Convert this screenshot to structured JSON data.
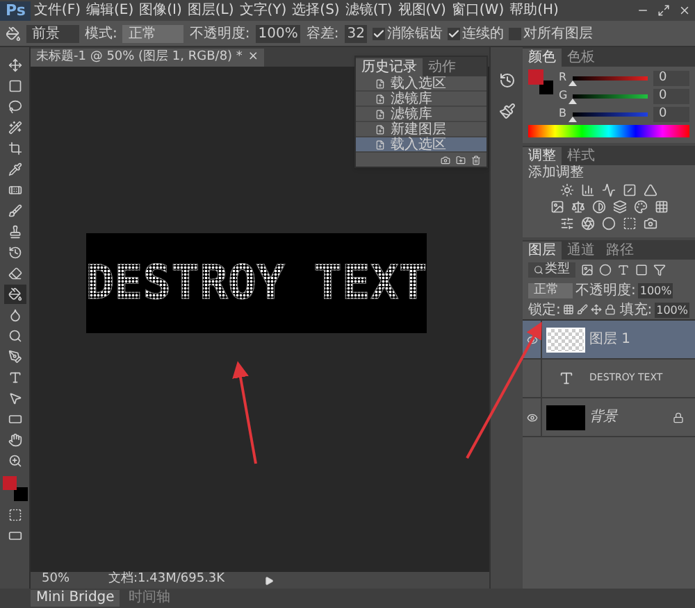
{
  "menu_bar": {
    "logo": "Ps",
    "items": [
      "文件(F)",
      "编辑(E)",
      "图像(I)",
      "图层(L)",
      "文字(Y)",
      "选择(S)",
      "滤镜(T)",
      "视图(V)",
      "窗口(W)",
      "帮助(H)"
    ]
  },
  "options_bar": {
    "fill_source": "前景",
    "mode_label": "模式:",
    "mode": "正常",
    "opacity_label": "不透明度:",
    "opacity": "100%",
    "tolerance_label": "容差:",
    "tolerance": "32",
    "checkboxes": [
      {
        "label": "消除锯齿",
        "checked": true
      },
      {
        "label": "连续的",
        "checked": true
      },
      {
        "label": "对所有图层",
        "checked": false
      }
    ]
  },
  "document_tab": {
    "title": "未标题-1 @ 50% (图层 1, RGB/8) *",
    "close": "×"
  },
  "tools": [
    {
      "selected": false
    },
    {
      "selected": false
    },
    {
      "selected": false
    },
    {
      "selected": false
    },
    {
      "selected": false
    },
    {
      "selected": false
    },
    {
      "selected": false
    },
    {
      "selected": false
    },
    {
      "selected": false
    },
    {
      "selected": false
    },
    {
      "selected": false
    },
    {
      "selected": true
    },
    {
      "selected": false
    },
    {
      "selected": false
    },
    {
      "selected": false
    },
    {
      "selected": false
    },
    {
      "selected": false
    },
    {
      "selected": false
    },
    {
      "selected": false
    },
    {
      "selected": false
    }
  ],
  "swatches": [
    {
      "kind": "foreground",
      "color": "#c41e2a"
    },
    {
      "kind": "background",
      "color": "#000000"
    }
  ],
  "canvas": {
    "text": "DESTROY TEXT"
  },
  "status_bar": {
    "zoom": "50%",
    "document": "文档:1.43M/695.3K"
  },
  "bottom_tabs": [
    {
      "label": "Mini Bridge",
      "selected": true
    },
    {
      "label": "时间轴",
      "selected": false
    }
  ],
  "history_panel": {
    "tabs": [
      {
        "label": "历史记录",
        "selected": true
      },
      {
        "label": "动作",
        "selected": false
      }
    ],
    "items": [
      {
        "label": "载入选区",
        "selected": false
      },
      {
        "label": "滤镜库",
        "selected": false
      },
      {
        "label": "滤镜库",
        "selected": false
      },
      {
        "label": "新建图层",
        "selected": false
      },
      {
        "label": "载入选区",
        "selected": true
      }
    ]
  },
  "color_panel": {
    "tabs": [
      {
        "label": "颜色",
        "selected": true
      },
      {
        "label": "色板",
        "selected": false
      }
    ],
    "channels": [
      {
        "name": "R",
        "level": 0,
        "reading": "0"
      },
      {
        "name": "G",
        "level": 0,
        "reading": "0"
      },
      {
        "name": "B",
        "level": 0,
        "reading": "0"
      }
    ]
  },
  "adjustments_panel": {
    "tabs": [
      {
        "label": "调整",
        "selected": true
      },
      {
        "label": "样式",
        "selected": false
      }
    ],
    "heading": "添加调整"
  },
  "layers_panel": {
    "tabs": [
      {
        "label": "图层",
        "selected": true
      },
      {
        "label": "通道",
        "selected": false
      },
      {
        "label": "路径",
        "selected": false
      }
    ],
    "filter": "类型",
    "blend_mode": "正常",
    "opacity_label": "不透明度:",
    "opacity": "100%",
    "lock_label": "锁定:",
    "fill_label": "填充:",
    "fill": "100%",
    "layers": [
      {
        "name": "图层 1",
        "kind": "pixel",
        "visible": true,
        "selected": true,
        "locked": false
      },
      {
        "name": "DESTROY TEXT",
        "kind": "text",
        "visible": false,
        "selected": false,
        "locked": false
      },
      {
        "name": "背景",
        "kind": "background",
        "visible": true,
        "selected": false,
        "locked": true
      }
    ]
  }
}
